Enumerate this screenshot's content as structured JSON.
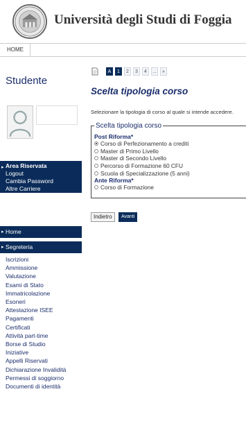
{
  "header": {
    "title": "Università degli Studi di Foggia",
    "home_tab": "HOME"
  },
  "sidebar": {
    "studente_label": "Studente",
    "area": {
      "title": "Area Riservata",
      "links": [
        "Logout",
        "Cambia Password",
        "Altre Carriere"
      ]
    },
    "nav_home": "Home",
    "nav_segreteria": "Segreteria",
    "menu": [
      "Iscrizioni",
      "Ammissione",
      "Valutazione",
      "Esami di Stato",
      "Immatricolazione",
      "Esoneri",
      "Attestazione ISEE",
      "Pagamenti",
      "Certificati",
      "Attività part-time",
      "Borse di Studio",
      "Iniziative",
      "Appelli Riservati",
      "Dichiarazione Invalidità",
      "Permessi di soggiorno",
      "Documenti di identità"
    ]
  },
  "pager": [
    "A",
    "1",
    "2",
    "3",
    "4",
    "...",
    "»"
  ],
  "main": {
    "title": "Scelta tipologia corso",
    "intro": "Selezionare la tipologia di corso al quale si intende accedere.",
    "legend": "Scelta tipologia corso",
    "group1": "Post Riforma*",
    "options1": [
      {
        "label": "Corso di Perfezionamento a crediti",
        "selected": true
      },
      {
        "label": "Master di Primo Livello",
        "selected": false
      },
      {
        "label": "Master di Secondo Livello",
        "selected": false
      },
      {
        "label": "Percorso di Formazione 60 CFU",
        "selected": false
      },
      {
        "label": "Scuola di Specializzazione (5 anni)",
        "selected": false
      }
    ],
    "group2": "Ante Riforma*",
    "options2": [
      {
        "label": "Corso di Formazione",
        "selected": false
      }
    ],
    "back_label": "Indietro",
    "next_label": "Avanti"
  },
  "colors": {
    "brand_navy": "#0b2c5a",
    "link_blue": "#1a2d6b"
  },
  "icons": {
    "logo": "university-seal-icon",
    "page": "document-icon",
    "avatar": "user-silhouette-icon",
    "nav_arrow": "caret-right-icon"
  }
}
